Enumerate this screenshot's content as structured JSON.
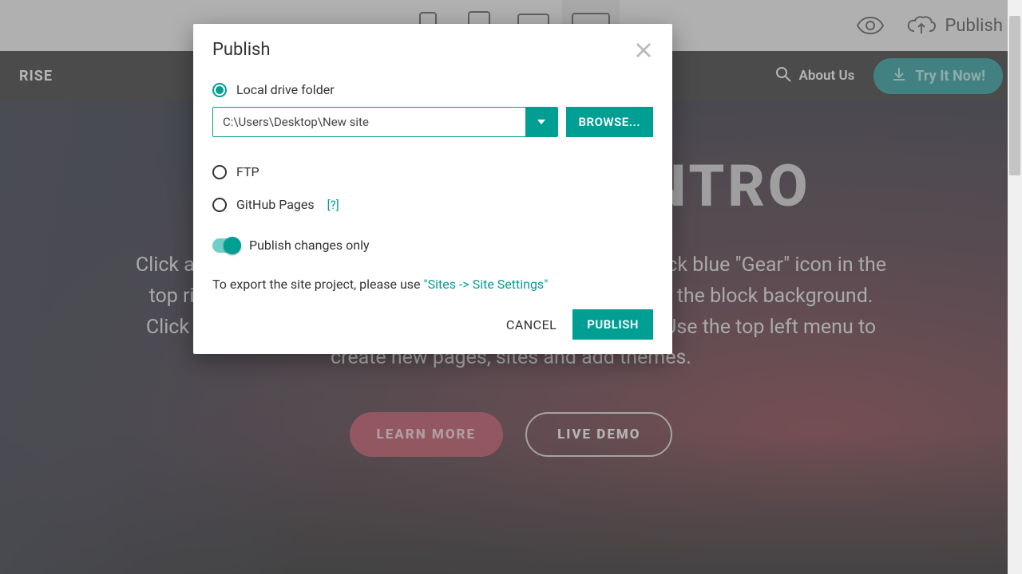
{
  "toolbar": {
    "publish_label": "Publish"
  },
  "site_header": {
    "brand": "RISE",
    "about_label": "About Us",
    "try_label": "Try It Now!"
  },
  "hero": {
    "title": "FULL SCREEN INTRO",
    "description": "Click any text to edit or style it. Select text to insert a link. Click blue \"Gear\" icon in the top right corner to hide/show buttons, text, title and change the block background. Click red \"+\" in the bottom right corner to add a new block. Use the top left menu to create new pages, sites and add themes.",
    "learn_more": "LEARN MORE",
    "live_demo": "LIVE DEMO"
  },
  "modal": {
    "title": "Publish",
    "option_local": "Local drive folder",
    "path_value": "C:\\Users\\Desktop\\New site",
    "browse": "BROWSE...",
    "option_ftp": "FTP",
    "option_github": "GitHub Pages",
    "github_help": "[?]",
    "changes_only": "Publish changes only",
    "export_prefix": "To export the site project, please use ",
    "export_link": "\"Sites -> Site Settings\"",
    "cancel": "CANCEL",
    "publish": "PUBLISH"
  }
}
